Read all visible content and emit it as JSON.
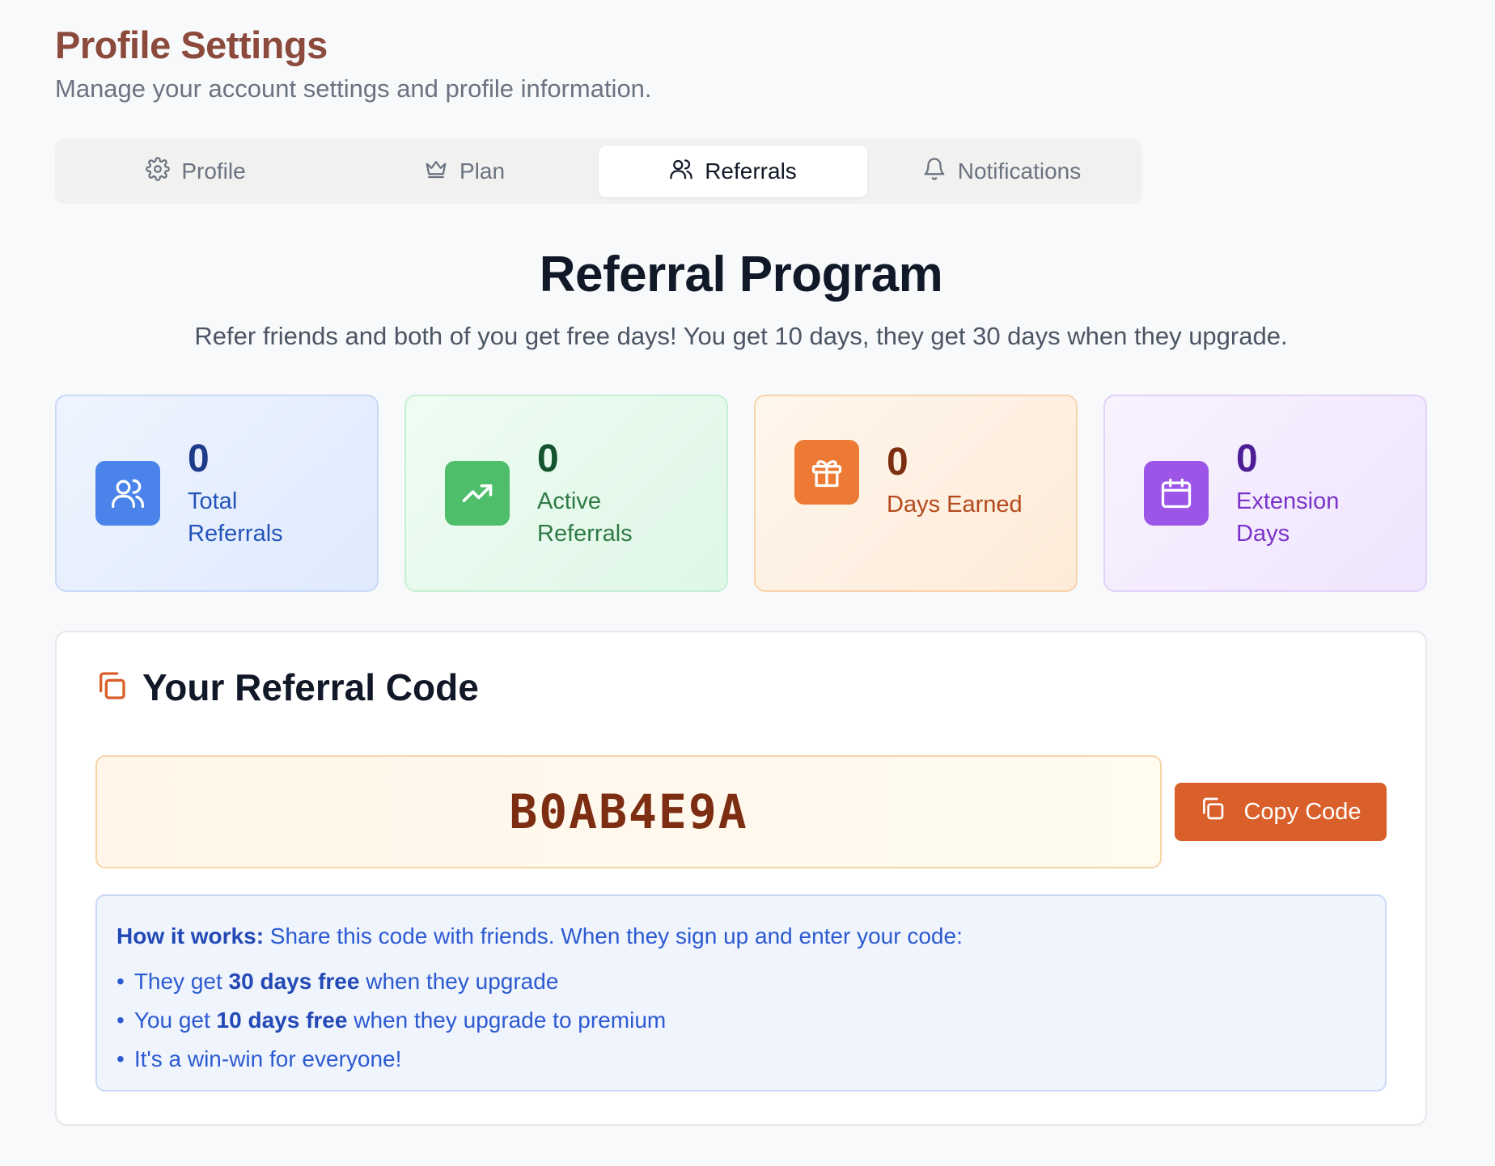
{
  "header": {
    "title": "Profile Settings",
    "subtitle": "Manage your account settings and profile information."
  },
  "tabs": [
    {
      "label": "Profile",
      "icon": "gear-icon"
    },
    {
      "label": "Plan",
      "icon": "crown-icon"
    },
    {
      "label": "Referrals",
      "icon": "users-icon",
      "active": true
    },
    {
      "label": "Notifications",
      "icon": "bell-icon"
    }
  ],
  "referral": {
    "title": "Referral Program",
    "subtitle": "Refer friends and both of you get free days! You get 10 days, they get 30 days when they upgrade."
  },
  "stats": [
    {
      "value": "0",
      "label": "Total Referrals",
      "icon": "users-icon",
      "color": "#4a84ea"
    },
    {
      "value": "0",
      "label": "Active Referrals",
      "icon": "trending-up-icon",
      "color": "#4fbe6a"
    },
    {
      "value": "0",
      "label": "Days Earned",
      "icon": "gift-icon",
      "color": "#ec7a34"
    },
    {
      "value": "0",
      "label": "Extension Days",
      "icon": "calendar-icon",
      "color": "#9d55e8"
    }
  ],
  "code_card": {
    "title": "Your Referral Code",
    "code": "B0AB4E9A",
    "copy_label": "Copy Code",
    "how": {
      "lead": "How it works:",
      "intro": " Share this code with friends. When they sign up and enter your code:",
      "items": [
        {
          "pre": "They get ",
          "bold": "30 days free",
          "post": " when they upgrade"
        },
        {
          "pre": "You get ",
          "bold": "10 days free",
          "post": " when they upgrade to premium"
        },
        {
          "pre": "It's a win-win for everyone!",
          "bold": "",
          "post": ""
        }
      ]
    }
  },
  "colors": {
    "accent": "#d9602a",
    "title": "#8b4a3c"
  }
}
